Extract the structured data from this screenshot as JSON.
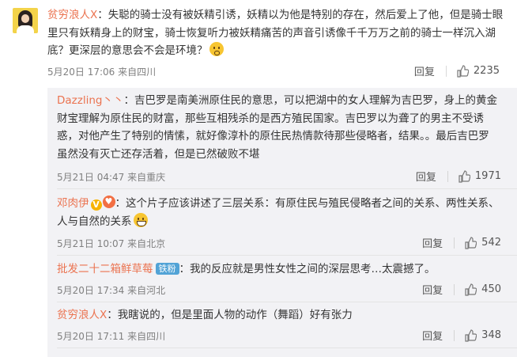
{
  "top_comment": {
    "author": "贫穷浪人X",
    "text": "失聪的骑士没有被妖精引诱，妖精以为他是特别的存在，然后爱上了他，但是骑士眼里只有妖精身上的财宝，骑士恢复听力被妖精痛苦的声音引诱像千千万万之前的骑士一样沉入湖底？更深层的意思会不会是环境？",
    "meta": "5月20日 17:06 来自四川",
    "reply_label": "回复",
    "likes": "2235"
  },
  "replies": [
    {
      "author": "Dazzling丶丶",
      "text": "吉巴罗是南美洲原住民的意思，可以把湖中的女人理解为吉巴罗，身上的黄金财宝理解为原住民的财富，那些互相残杀的是西方殖民国家。吉巴罗以为聋了的男主不受诱惑，对他产生了特别的情愫，就好像淳朴的原住民热情款待那些侵略者，结果。。最后吉巴罗虽然没有灭亡还存活着，但是已然破败不堪",
      "meta": "5月21日 04:47 来自重庆",
      "reply_label": "回复",
      "likes": "1971"
    },
    {
      "author": "邓肉伊",
      "badge": "V",
      "text": "这个片子应该讲述了三层关系：有原住民与殖民侵略者之间的关系、两性关系、人与自然的关系",
      "meta": "5月21日 10:07 来自北京",
      "reply_label": "回复",
      "likes": "542"
    },
    {
      "author": "批发二十二箱鲜草莓",
      "badge": "铁粉",
      "text": "我的反应就是男性女性之间的深层思考…太震撼了。",
      "meta": "5月20日 17:34 来自河北",
      "reply_label": "回复",
      "likes": "450"
    },
    {
      "author": "贫穷浪人X",
      "text": "我瞎说的，但是里面人物的动作（舞蹈）好有张力",
      "meta": "5月20日 17:11 来自四川",
      "reply_label": "回复",
      "likes": "348"
    }
  ]
}
